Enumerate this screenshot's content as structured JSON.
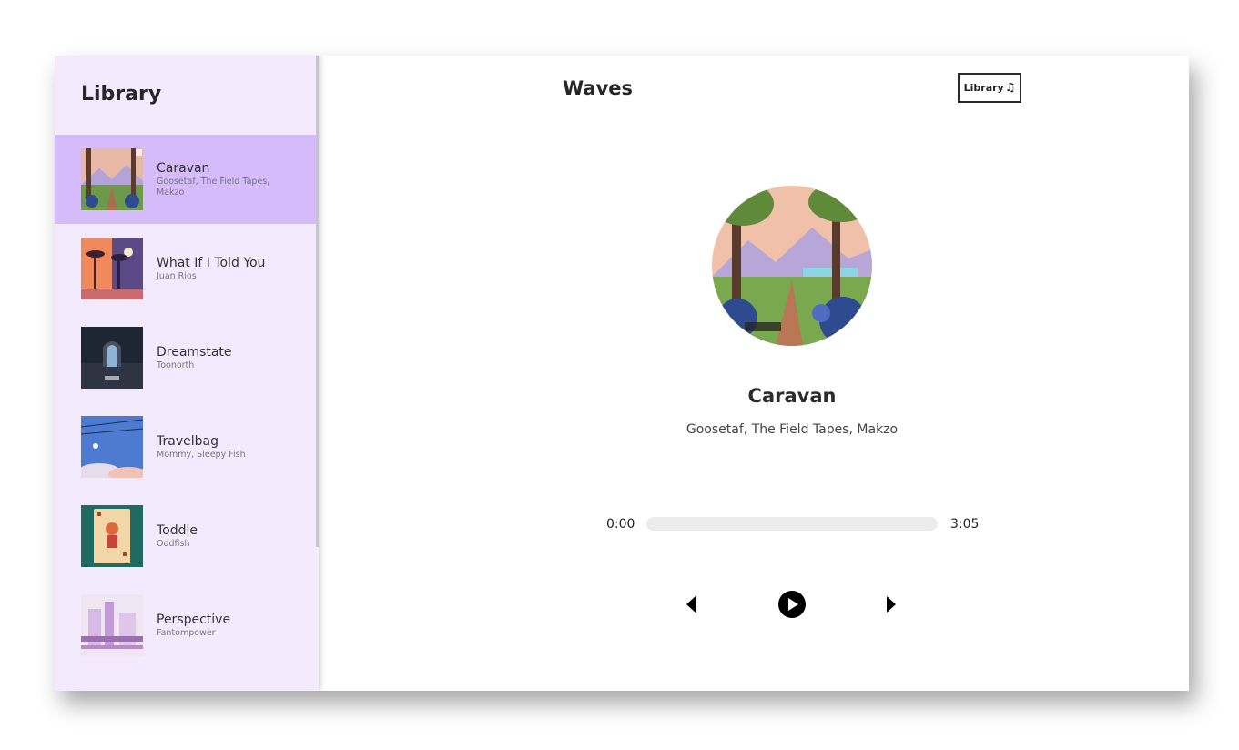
{
  "sidebar": {
    "title": "Library",
    "songs": [
      {
        "name": "Caravan",
        "artist": "Goosetaf, The Field Tapes, Makzo",
        "active": true,
        "art": "forest-landscape"
      },
      {
        "name": "What If I Told You",
        "artist": "Juan Rios",
        "active": false,
        "art": "palm-sunset"
      },
      {
        "name": "Dreamstate",
        "artist": "Toonorth",
        "active": false,
        "art": "ruined-arch"
      },
      {
        "name": "Travelbag",
        "artist": "Mommy, Sleepy Fish",
        "active": false,
        "art": "blue-sky"
      },
      {
        "name": "Toddle",
        "artist": "Oddfish",
        "active": false,
        "art": "card-character"
      },
      {
        "name": "Perspective",
        "artist": "Fantompower",
        "active": false,
        "art": "pink-city"
      }
    ]
  },
  "header": {
    "title": "Waves",
    "library_button_label": "Library",
    "library_button_icon": "music-note-icon"
  },
  "player": {
    "title": "Caravan",
    "artist": "Goosetaf, The Field Tapes, Makzo",
    "current_time": "0:00",
    "duration": "3:05",
    "progress": 0,
    "controls": [
      "skip-back-icon",
      "play-icon",
      "skip-forward-icon"
    ]
  },
  "colors": {
    "sidebar_bg": "#f4eafe",
    "active_song_bg": "#d6bbfb",
    "track_bg": "#ececec"
  }
}
